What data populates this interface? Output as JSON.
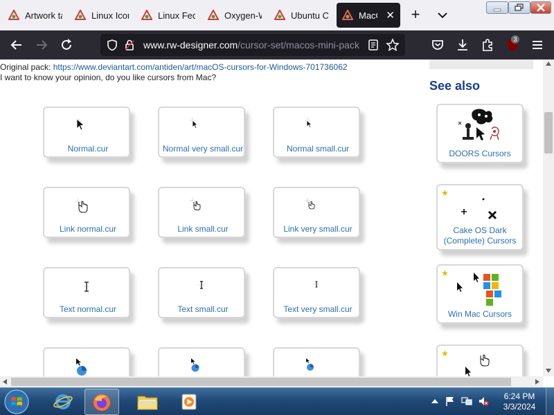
{
  "tabs": [
    {
      "label": "Artwork ta"
    },
    {
      "label": "Linux Icon"
    },
    {
      "label": "Linux Fed"
    },
    {
      "label": "Oxygen-W"
    },
    {
      "label": "Ubuntu C"
    },
    {
      "label": "MacOS"
    }
  ],
  "nav": {
    "url_host": "www.rw-designer.com",
    "url_path": "/cursor-set/macos-mini-pack",
    "extensions_badge": "3"
  },
  "intro": {
    "pack_label": "Original pack: ",
    "pack_link": "https://www.deviantart.com/antiden/art/macOS-cursors-for-Windows-701736062",
    "question": "I want to know your opinion, do you like cursors from Mac?"
  },
  "cursors": [
    {
      "name": "Normal.cur"
    },
    {
      "name": "Normal very small.cur"
    },
    {
      "name": "Normal small.cur"
    },
    {
      "name": "Link normal.cur"
    },
    {
      "name": "Link small.cur"
    },
    {
      "name": "Link very small.cur"
    },
    {
      "name": "Text normal.cur"
    },
    {
      "name": "Text small.cur"
    },
    {
      "name": "Text very small.cur"
    }
  ],
  "see_also": {
    "title": "See also",
    "items": [
      {
        "name": "DOORS Cursors"
      },
      {
        "name": "Cake OS Dark (Complete) Cursors"
      },
      {
        "name": "Win Mac Cursors"
      }
    ]
  },
  "taskbar": {
    "time": "6:24 PM",
    "date": "3/3/2024"
  },
  "colors": {
    "active_tab": "#1c1b22",
    "nav_bg": "#2b2a33",
    "link": "#2a6fb0",
    "see_also_title": "#1a3c8c",
    "star": "#e6b800"
  }
}
